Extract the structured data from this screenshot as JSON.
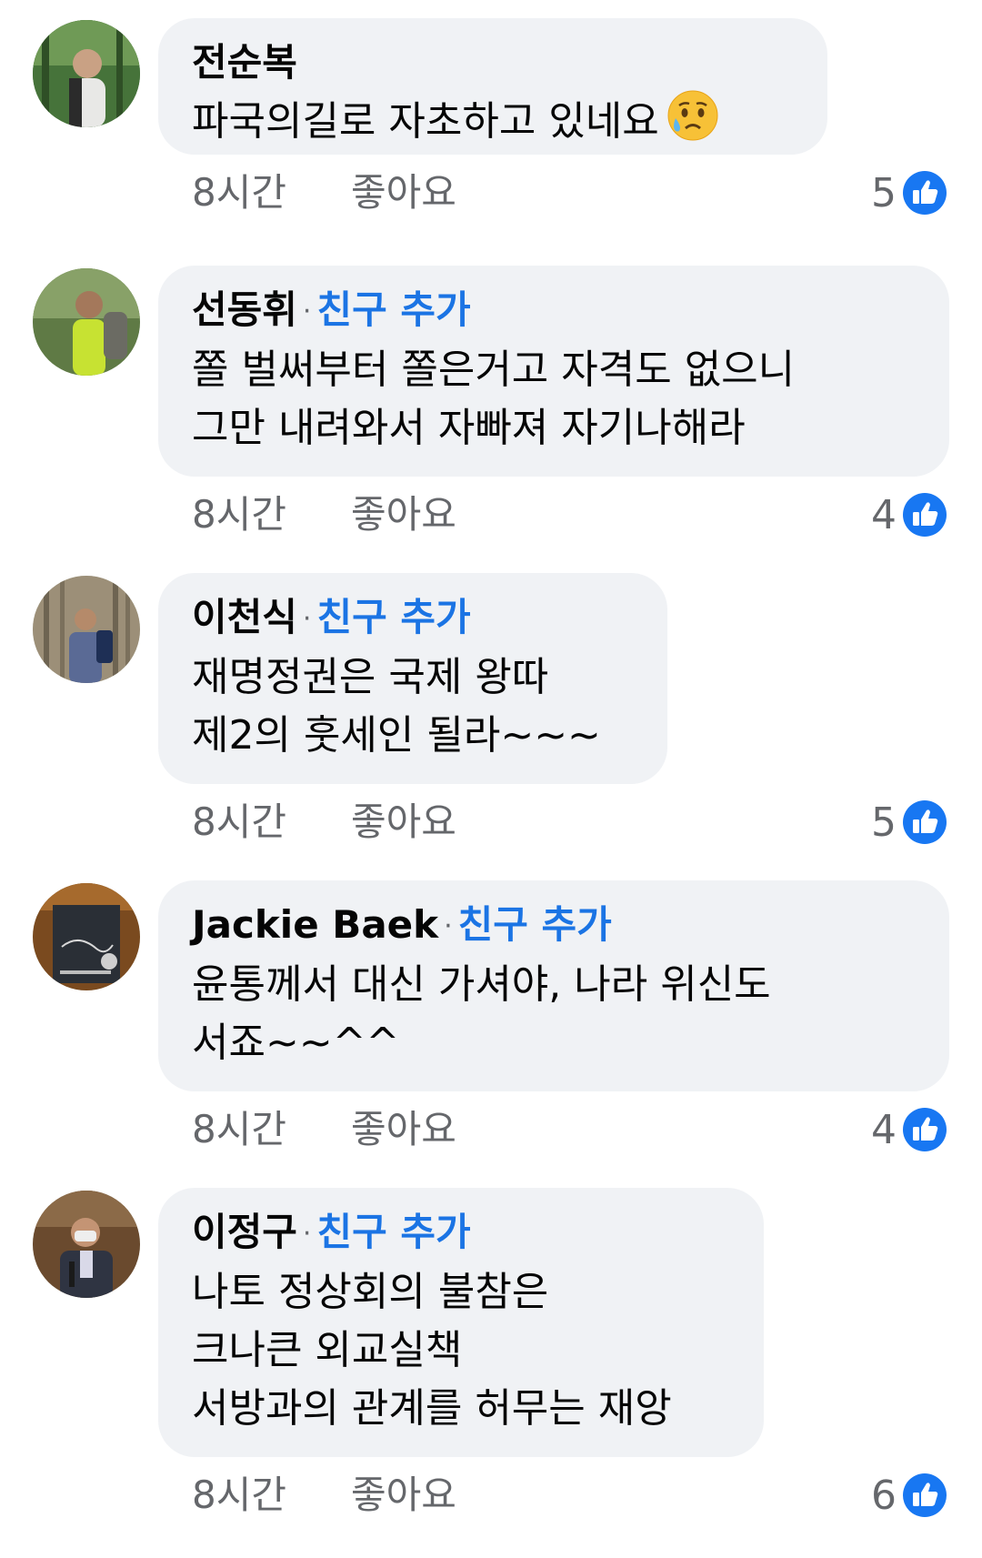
{
  "comments": [
    {
      "name": "전순복",
      "add_friend": "",
      "lines": [
        "파국의길로 자초하고 있네요"
      ],
      "time": "8시간",
      "like_label": "좋아요",
      "reaction_count": "5",
      "emoji": "crying-face"
    },
    {
      "name": "선동휘",
      "add_friend": "친구 추가",
      "lines": [
        "쫄 벌써부터 쫄은거고 자격도 없으니",
        "그만 내려와서 자빠져 자기나해라"
      ],
      "time": "8시간",
      "like_label": "좋아요",
      "reaction_count": "4"
    },
    {
      "name": "이천식",
      "add_friend": "친구 추가",
      "lines": [
        "재명정권은 국제 왕따",
        "제2의 훗세인 될라~~~"
      ],
      "time": "8시간",
      "like_label": "좋아요",
      "reaction_count": "5"
    },
    {
      "name": "Jackie Baek",
      "add_friend": "친구 추가",
      "lines": [
        "윤통께서 대신 가셔야, 나라 위신도",
        "서죠~~^^"
      ],
      "time": "8시간",
      "like_label": "좋아요",
      "reaction_count": "4"
    },
    {
      "name": "이정구",
      "add_friend": "친구 추가",
      "lines": [
        "나토 정상회의 불참은",
        "크나큰 외교실책",
        "서방과의 관계를 허무는 재앙"
      ],
      "time": "8시간",
      "like_label": "좋아요",
      "reaction_count": "6"
    }
  ],
  "separator": "·",
  "colors": {
    "bubble": "#f0f2f5",
    "link_blue": "#1b74e4",
    "meta_gray": "#65676b",
    "like_blue": "#1877f2"
  }
}
